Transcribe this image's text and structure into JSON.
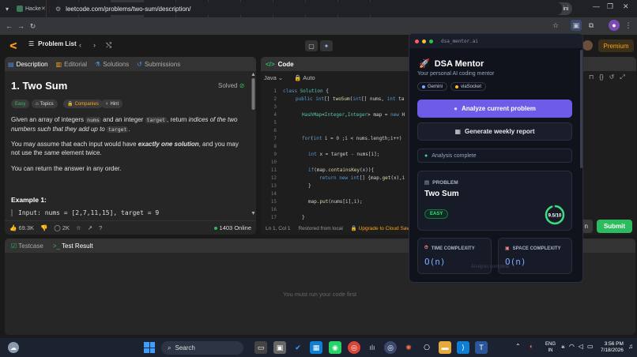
{
  "browser": {
    "tabs": [
      {
        "label": "Hacke",
        "color": "#3b7a57",
        "glyph": "■"
      },
      {
        "label": "viaSoc",
        "color": "#c62828",
        "glyph": "■"
      },
      {
        "label": "Subse",
        "color": "#3a3a3a",
        "glyph": "■"
      },
      {
        "label": "Two S",
        "color": "#ffa116",
        "glyph": "■",
        "active": true
      },
      {
        "label": "Probl",
        "color": "#3a3a3a",
        "glyph": "■"
      },
      {
        "label": "Exten",
        "color": "#5f6368",
        "glyph": "✦"
      },
      {
        "label": "Probl",
        "color": "#3a3a3a",
        "glyph": "■"
      },
      {
        "label": "Inbox",
        "color": "#ea4335",
        "glyph": "M"
      },
      {
        "label": "PyDa",
        "color": "#24292e",
        "glyph": "●"
      },
      {
        "label": "Slowl",
        "color": "#888",
        "glyph": "●"
      },
      {
        "label": "Estim",
        "color": "#eee",
        "glyph": "A"
      }
    ],
    "ask_gemini": "Ask Gemini",
    "url": "leetcode.com/problems/two-sum/description/"
  },
  "lc": {
    "problem_list": "Problem List",
    "premium": "Premium",
    "desc_tabs": [
      "Description",
      "Editorial",
      "Solutions",
      "Submissions"
    ],
    "title": "1. Two Sum",
    "solved": "Solved",
    "chips": [
      "Easy",
      "Topics",
      "Companies",
      "Hint"
    ],
    "p1a": "Given an array of integers ",
    "p1code1": "nums",
    "p1b": " and an integer ",
    "p1code2": "target",
    "p1c": ", return ",
    "p1em": "indices of the two numbers such that they add up to",
    "p1code3": "target",
    "p2a": "You may assume that each input would have ",
    "p2b": "exactly one solution",
    "p2c": ", and you may not use the ",
    "p2d": "same",
    "p2e": " element twice.",
    "p3": "You can return the answer in any order.",
    "example": "Example 1:",
    "example_input": "Input: nums = [2,7,11,15], target = 9",
    "likes": "69.3K",
    "comments": "2K",
    "online": "1403 Online",
    "code_tab": "Code",
    "lang": "Java",
    "auto": "Auto",
    "status_pos": "Ln 1, Col 1",
    "status_restored": "Restored from local",
    "status_upgrade": "Upgrade to Cloud Saving",
    "submit": "Submit",
    "run": "n",
    "bottom_tabs": [
      "Testcase",
      "Test Result"
    ],
    "must_run": "You must run your code first"
  },
  "taskbar": {
    "search": "Search",
    "lang1": "ENG",
    "lang2": "IN",
    "time": "3:56 PM",
    "date": "7/18/2026"
  },
  "mentor": {
    "file": "dsa_mentor.ai",
    "title": "DSA Mentor",
    "subtitle": "Your personal AI coding mentor",
    "chip1": "Gemini",
    "chip2": "viaSocket",
    "analyze": "Analyze current problem",
    "weekly": "Generate weekly report",
    "status": "Analysis complete",
    "problem_label": "PROBLEM",
    "problem_name": "Two Sum",
    "difficulty": "EASY",
    "score": "9.5/10",
    "score_fraction": 0.95,
    "time_label": "TIME COMPLEXITY",
    "time_value": "O(n)",
    "space_label": "SPACE COMPLEXITY",
    "space_value": "O(n)",
    "ghost": "Analysis complete"
  },
  "colors": {
    "accent": "#ffa116",
    "success": "#2cbb5d",
    "mentor_primary": "#6c5ce7"
  }
}
